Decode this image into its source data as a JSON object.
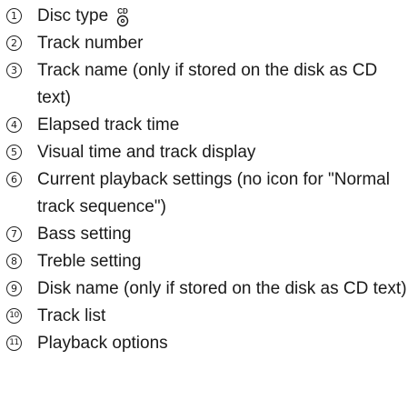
{
  "legend": {
    "items": [
      {
        "number": "1",
        "text": "Disc type",
        "icon": "cd-disc-icon"
      },
      {
        "number": "2",
        "text": "Track number"
      },
      {
        "number": "3",
        "text": "Track name (only if stored on the disk as CD text)"
      },
      {
        "number": "4",
        "text": "Elapsed track time"
      },
      {
        "number": "5",
        "text": "Visual time and track display"
      },
      {
        "number": "6",
        "text": "Current playback settings (no icon for \"Normal track sequence\")"
      },
      {
        "number": "7",
        "text": "Bass setting"
      },
      {
        "number": "8",
        "text": "Treble setting"
      },
      {
        "number": "9",
        "text": "Disk name (only if stored on the disk as CD text)"
      },
      {
        "number": "10",
        "text": "Track list"
      },
      {
        "number": "11",
        "text": "Playback options"
      }
    ]
  }
}
